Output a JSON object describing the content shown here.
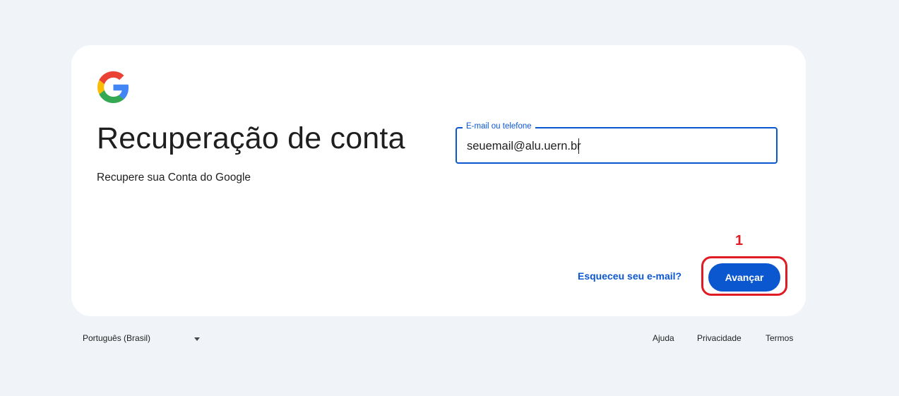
{
  "card": {
    "title": "Recuperação de conta",
    "subtitle": "Recupere sua Conta do Google"
  },
  "email_field": {
    "label": "E-mail ou telefone",
    "value": "seuemail@alu.uern.br"
  },
  "actions": {
    "forgot_email": "Esqueceu seu e-mail?",
    "next": "Avançar"
  },
  "annotation": {
    "number": "1",
    "color": "#e01b24"
  },
  "footer": {
    "language": "Português (Brasil)",
    "help": "Ajuda",
    "privacy": "Privacidade",
    "terms": "Termos"
  },
  "colors": {
    "accent": "#0b57d0",
    "background": "#f0f4f9"
  },
  "icons": {
    "logo": "google-g-logo",
    "language_dropdown": "caret-down-icon"
  }
}
